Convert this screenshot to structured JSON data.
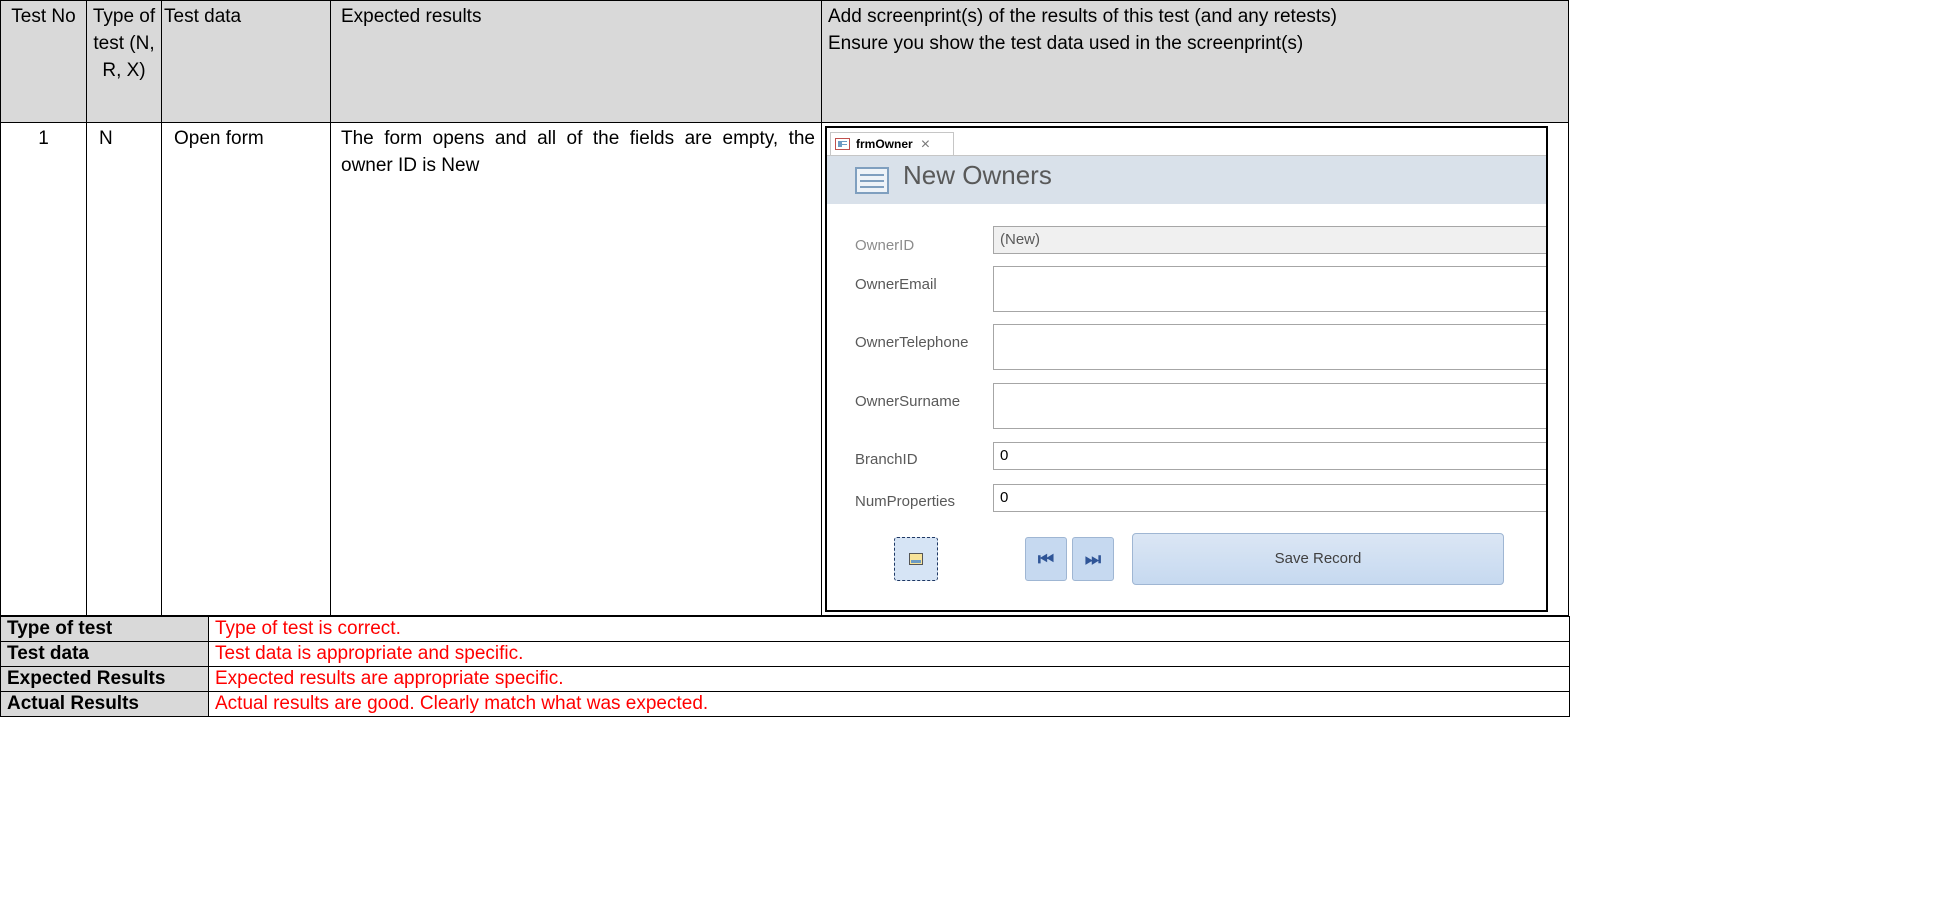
{
  "doc": {
    "stub_text": "p"
  },
  "header": {
    "test_no": "Test No",
    "type_of_test": "Type of test (N, R, X)",
    "test_data": "Test data",
    "expected_results": "Expected results",
    "screenprint": "Add screenprint(s) of the results of this test (and any retests) Ensure you show the test data used in the screenprint(s)"
  },
  "row": {
    "test_no": "1",
    "type": "N",
    "test_data": "Open form",
    "expected": "The form opens and all of the fields are empty, the owner ID is New"
  },
  "form": {
    "tab_label": "frmOwner",
    "close_glyph": "×",
    "title": "New Owners",
    "fields": [
      {
        "label": "OwnerID",
        "value": "(New)"
      },
      {
        "label": "OwnerEmail",
        "value": ""
      },
      {
        "label": "OwnerTelephone",
        "value": ""
      },
      {
        "label": "OwnerSurname",
        "value": ""
      },
      {
        "label": "BranchID",
        "value": "0"
      },
      {
        "label": "NumProperties",
        "value": "0"
      }
    ],
    "first_record_glyph": "⏮",
    "last_record_glyph": "⏭",
    "save_label": "Save Record",
    "icons": [
      "form-icon",
      "folder-icon",
      "first-record-icon",
      "last-record-icon",
      "close-icon"
    ]
  },
  "review": [
    {
      "label": "Type of test",
      "comment": "Type of test is correct."
    },
    {
      "label": "Test data",
      "comment": "Test data is appropriate and specific."
    },
    {
      "label": "Expected Results",
      "comment": "Expected results are appropriate specific."
    },
    {
      "label": "Actual Results",
      "comment": "Actual results are good.  Clearly match what was expected."
    }
  ],
  "colors": {
    "header_bg": "#d9d9d9",
    "comment": "#ff0000",
    "form_header_bg": "#d9e1ea",
    "button_bg": "#c6d9f0"
  }
}
